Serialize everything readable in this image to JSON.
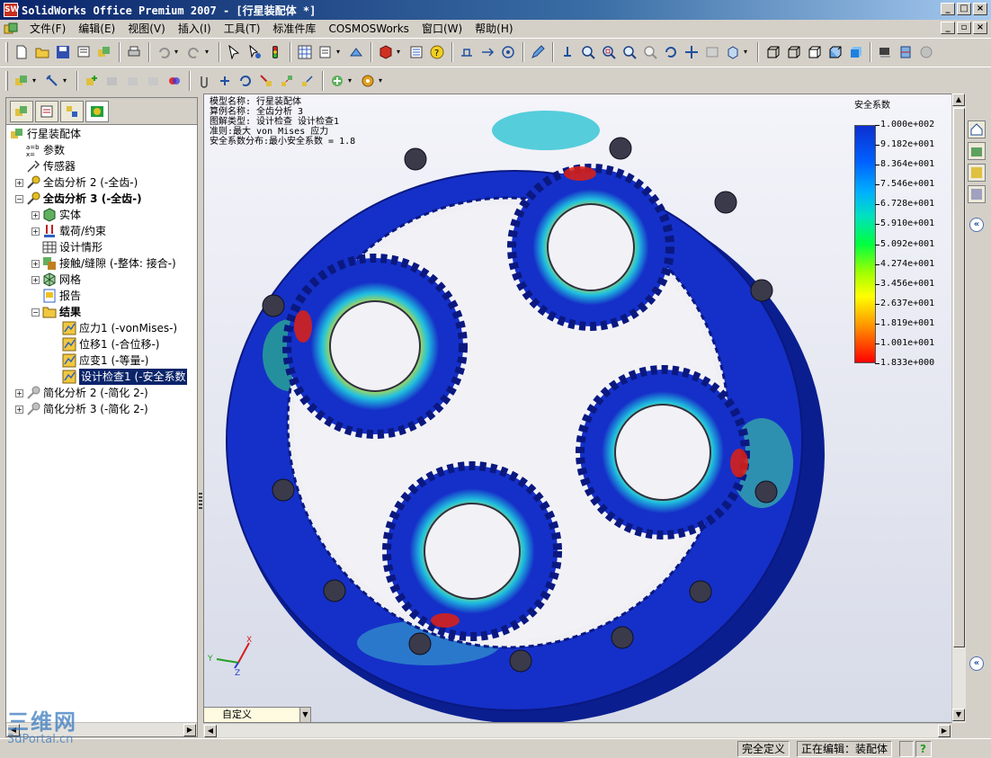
{
  "window": {
    "title": "SolidWorks Office Premium 2007 - [行星装配体 *]",
    "app_icon_text": "SW"
  },
  "menu": [
    "文件(F)",
    "编辑(E)",
    "视图(V)",
    "插入(I)",
    "工具(T)",
    "标准件库",
    "COSMOSWorks",
    "窗口(W)",
    "帮助(H)"
  ],
  "tree": {
    "root": "行星装配体",
    "items": [
      {
        "label": "参数",
        "icon": "equation-icon"
      },
      {
        "label": "传感器",
        "icon": "sensor-icon"
      },
      {
        "label": "全齿分析 2 (-全齿-)",
        "icon": "study-icon"
      },
      {
        "label": "全齿分析 3 (-全齿-)",
        "icon": "study-icon",
        "bold": true
      },
      {
        "label": "实体",
        "icon": "solid-icon"
      },
      {
        "label": "载荷/约束",
        "icon": "load-icon"
      },
      {
        "label": "设计情形",
        "icon": "table-icon"
      },
      {
        "label": "接触/缝隙 (-整体: 接合-)",
        "icon": "contact-icon"
      },
      {
        "label": "网格",
        "icon": "mesh-icon"
      },
      {
        "label": "报告",
        "icon": "report-icon"
      },
      {
        "label": "结果",
        "icon": "folder-icon",
        "bold": true
      },
      {
        "label": "应力1 (-vonMises-)",
        "icon": "plot-icon"
      },
      {
        "label": "位移1 (-合位移-)",
        "icon": "plot-icon"
      },
      {
        "label": "应变1 (-等量-)",
        "icon": "plot-icon"
      },
      {
        "label": "设计检查1 (-安全系数",
        "icon": "plot-icon",
        "selected": true
      },
      {
        "label": "简化分析 2 (-简化 2-)",
        "icon": "study-icon"
      },
      {
        "label": "简化分析 3 (-简化 2-)",
        "icon": "study-icon"
      }
    ]
  },
  "plot_info": {
    "line1": "模型名称: 行星装配体",
    "line2": "算例名称: 全齿分析 3",
    "line3": "图解类型: 设计检查 设计检查1",
    "line4": "准则:最大 von Mises 应力",
    "line5": "安全系数分布:最小安全系数 = 1.8"
  },
  "legend": {
    "title": "安全系数",
    "labels": [
      "1.000e+002",
      "9.182e+001",
      "8.364e+001",
      "7.546e+001",
      "6.728e+001",
      "5.910e+001",
      "5.092e+001",
      "4.274e+001",
      "3.456e+001",
      "2.637e+001",
      "1.819e+001",
      "1.001e+001",
      "1.833e+000"
    ]
  },
  "triad": {
    "x": "X",
    "y": "Y",
    "z": "Z"
  },
  "config_combo": "自定义",
  "status": {
    "fully_defined": "完全定义",
    "editing": "正在编辑：装配体",
    "help": "?"
  },
  "watermark": {
    "line1": "三维网",
    "line2": "3dPortal.cn"
  },
  "colors": {
    "title_blue": "#0a246a",
    "fea_blue": "#1530c8",
    "fea_red": "#e02010"
  }
}
